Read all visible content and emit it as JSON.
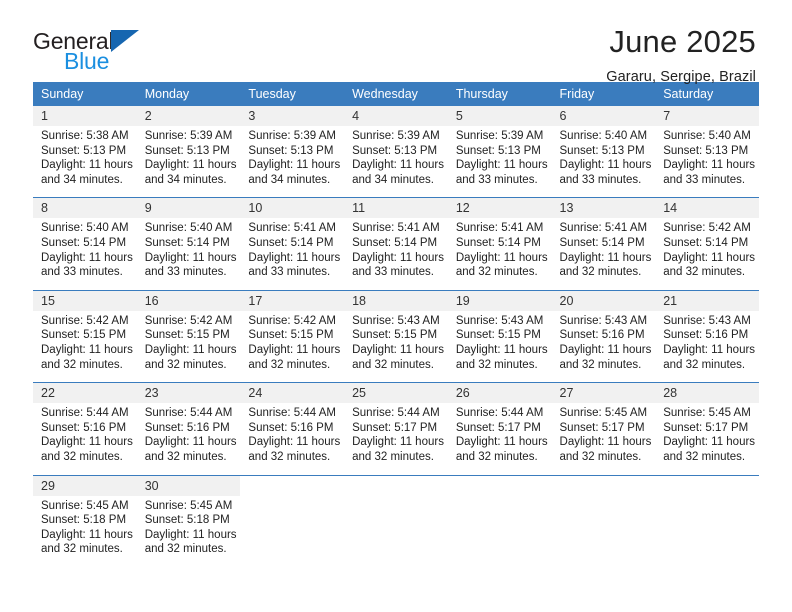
{
  "brand": {
    "name_part1": "General",
    "name_part2": "Blue",
    "accent_color": "#1b8fe0",
    "triangle_color": "#1666b0"
  },
  "header": {
    "title": "June 2025",
    "subtitle": "Gararu, Sergipe, Brazil"
  },
  "calendar": {
    "header_bg": "#3a7cbe",
    "daynum_bg": "#f1f1f1",
    "weekdays": [
      "Sunday",
      "Monday",
      "Tuesday",
      "Wednesday",
      "Thursday",
      "Friday",
      "Saturday"
    ],
    "weeks": [
      {
        "days": [
          {
            "num": "1",
            "sunrise": "Sunrise: 5:38 AM",
            "sunset": "Sunset: 5:13 PM",
            "daylight1": "Daylight: 11 hours",
            "daylight2": "and 34 minutes."
          },
          {
            "num": "2",
            "sunrise": "Sunrise: 5:39 AM",
            "sunset": "Sunset: 5:13 PM",
            "daylight1": "Daylight: 11 hours",
            "daylight2": "and 34 minutes."
          },
          {
            "num": "3",
            "sunrise": "Sunrise: 5:39 AM",
            "sunset": "Sunset: 5:13 PM",
            "daylight1": "Daylight: 11 hours",
            "daylight2": "and 34 minutes."
          },
          {
            "num": "4",
            "sunrise": "Sunrise: 5:39 AM",
            "sunset": "Sunset: 5:13 PM",
            "daylight1": "Daylight: 11 hours",
            "daylight2": "and 34 minutes."
          },
          {
            "num": "5",
            "sunrise": "Sunrise: 5:39 AM",
            "sunset": "Sunset: 5:13 PM",
            "daylight1": "Daylight: 11 hours",
            "daylight2": "and 33 minutes."
          },
          {
            "num": "6",
            "sunrise": "Sunrise: 5:40 AM",
            "sunset": "Sunset: 5:13 PM",
            "daylight1": "Daylight: 11 hours",
            "daylight2": "and 33 minutes."
          },
          {
            "num": "7",
            "sunrise": "Sunrise: 5:40 AM",
            "sunset": "Sunset: 5:13 PM",
            "daylight1": "Daylight: 11 hours",
            "daylight2": "and 33 minutes."
          }
        ]
      },
      {
        "days": [
          {
            "num": "8",
            "sunrise": "Sunrise: 5:40 AM",
            "sunset": "Sunset: 5:14 PM",
            "daylight1": "Daylight: 11 hours",
            "daylight2": "and 33 minutes."
          },
          {
            "num": "9",
            "sunrise": "Sunrise: 5:40 AM",
            "sunset": "Sunset: 5:14 PM",
            "daylight1": "Daylight: 11 hours",
            "daylight2": "and 33 minutes."
          },
          {
            "num": "10",
            "sunrise": "Sunrise: 5:41 AM",
            "sunset": "Sunset: 5:14 PM",
            "daylight1": "Daylight: 11 hours",
            "daylight2": "and 33 minutes."
          },
          {
            "num": "11",
            "sunrise": "Sunrise: 5:41 AM",
            "sunset": "Sunset: 5:14 PM",
            "daylight1": "Daylight: 11 hours",
            "daylight2": "and 33 minutes."
          },
          {
            "num": "12",
            "sunrise": "Sunrise: 5:41 AM",
            "sunset": "Sunset: 5:14 PM",
            "daylight1": "Daylight: 11 hours",
            "daylight2": "and 32 minutes."
          },
          {
            "num": "13",
            "sunrise": "Sunrise: 5:41 AM",
            "sunset": "Sunset: 5:14 PM",
            "daylight1": "Daylight: 11 hours",
            "daylight2": "and 32 minutes."
          },
          {
            "num": "14",
            "sunrise": "Sunrise: 5:42 AM",
            "sunset": "Sunset: 5:14 PM",
            "daylight1": "Daylight: 11 hours",
            "daylight2": "and 32 minutes."
          }
        ]
      },
      {
        "days": [
          {
            "num": "15",
            "sunrise": "Sunrise: 5:42 AM",
            "sunset": "Sunset: 5:15 PM",
            "daylight1": "Daylight: 11 hours",
            "daylight2": "and 32 minutes."
          },
          {
            "num": "16",
            "sunrise": "Sunrise: 5:42 AM",
            "sunset": "Sunset: 5:15 PM",
            "daylight1": "Daylight: 11 hours",
            "daylight2": "and 32 minutes."
          },
          {
            "num": "17",
            "sunrise": "Sunrise: 5:42 AM",
            "sunset": "Sunset: 5:15 PM",
            "daylight1": "Daylight: 11 hours",
            "daylight2": "and 32 minutes."
          },
          {
            "num": "18",
            "sunrise": "Sunrise: 5:43 AM",
            "sunset": "Sunset: 5:15 PM",
            "daylight1": "Daylight: 11 hours",
            "daylight2": "and 32 minutes."
          },
          {
            "num": "19",
            "sunrise": "Sunrise: 5:43 AM",
            "sunset": "Sunset: 5:15 PM",
            "daylight1": "Daylight: 11 hours",
            "daylight2": "and 32 minutes."
          },
          {
            "num": "20",
            "sunrise": "Sunrise: 5:43 AM",
            "sunset": "Sunset: 5:16 PM",
            "daylight1": "Daylight: 11 hours",
            "daylight2": "and 32 minutes."
          },
          {
            "num": "21",
            "sunrise": "Sunrise: 5:43 AM",
            "sunset": "Sunset: 5:16 PM",
            "daylight1": "Daylight: 11 hours",
            "daylight2": "and 32 minutes."
          }
        ]
      },
      {
        "days": [
          {
            "num": "22",
            "sunrise": "Sunrise: 5:44 AM",
            "sunset": "Sunset: 5:16 PM",
            "daylight1": "Daylight: 11 hours",
            "daylight2": "and 32 minutes."
          },
          {
            "num": "23",
            "sunrise": "Sunrise: 5:44 AM",
            "sunset": "Sunset: 5:16 PM",
            "daylight1": "Daylight: 11 hours",
            "daylight2": "and 32 minutes."
          },
          {
            "num": "24",
            "sunrise": "Sunrise: 5:44 AM",
            "sunset": "Sunset: 5:16 PM",
            "daylight1": "Daylight: 11 hours",
            "daylight2": "and 32 minutes."
          },
          {
            "num": "25",
            "sunrise": "Sunrise: 5:44 AM",
            "sunset": "Sunset: 5:17 PM",
            "daylight1": "Daylight: 11 hours",
            "daylight2": "and 32 minutes."
          },
          {
            "num": "26",
            "sunrise": "Sunrise: 5:44 AM",
            "sunset": "Sunset: 5:17 PM",
            "daylight1": "Daylight: 11 hours",
            "daylight2": "and 32 minutes."
          },
          {
            "num": "27",
            "sunrise": "Sunrise: 5:45 AM",
            "sunset": "Sunset: 5:17 PM",
            "daylight1": "Daylight: 11 hours",
            "daylight2": "and 32 minutes."
          },
          {
            "num": "28",
            "sunrise": "Sunrise: 5:45 AM",
            "sunset": "Sunset: 5:17 PM",
            "daylight1": "Daylight: 11 hours",
            "daylight2": "and 32 minutes."
          }
        ]
      },
      {
        "days": [
          {
            "num": "29",
            "sunrise": "Sunrise: 5:45 AM",
            "sunset": "Sunset: 5:18 PM",
            "daylight1": "Daylight: 11 hours",
            "daylight2": "and 32 minutes."
          },
          {
            "num": "30",
            "sunrise": "Sunrise: 5:45 AM",
            "sunset": "Sunset: 5:18 PM",
            "daylight1": "Daylight: 11 hours",
            "daylight2": "and 32 minutes."
          },
          {
            "num": "",
            "sunrise": "",
            "sunset": "",
            "daylight1": "",
            "daylight2": ""
          },
          {
            "num": "",
            "sunrise": "",
            "sunset": "",
            "daylight1": "",
            "daylight2": ""
          },
          {
            "num": "",
            "sunrise": "",
            "sunset": "",
            "daylight1": "",
            "daylight2": ""
          },
          {
            "num": "",
            "sunrise": "",
            "sunset": "",
            "daylight1": "",
            "daylight2": ""
          },
          {
            "num": "",
            "sunrise": "",
            "sunset": "",
            "daylight1": "",
            "daylight2": ""
          }
        ]
      }
    ]
  }
}
